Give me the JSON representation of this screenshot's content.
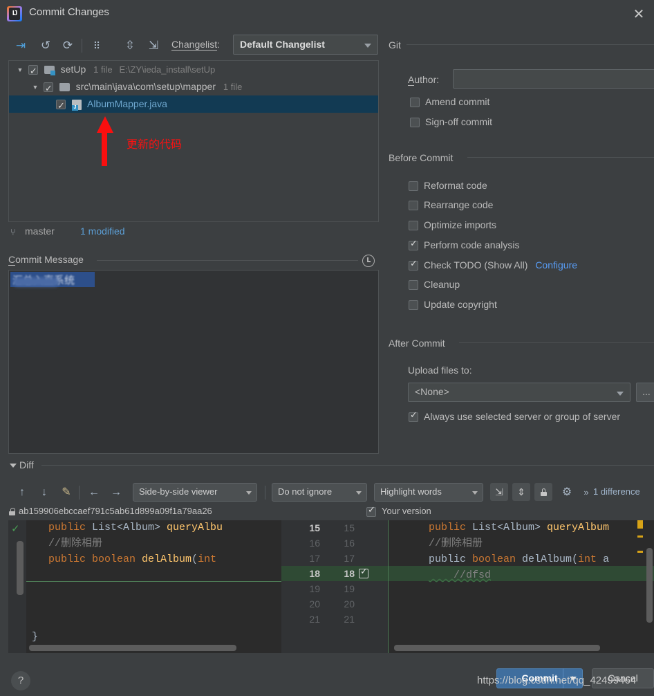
{
  "window": {
    "title": "Commit Changes",
    "app_icon": "intellij-idea-icon",
    "close_icon": "✕"
  },
  "toolbar": {
    "icons": [
      {
        "name": "show-diff-icon",
        "glyph": "⇥"
      },
      {
        "name": "revert-icon",
        "glyph": "↺"
      },
      {
        "name": "refresh-icon",
        "glyph": "⟳"
      },
      {
        "name": "group-by-icon",
        "glyph": "⠿"
      },
      {
        "name": "expand-all-icon",
        "glyph": "⇳"
      },
      {
        "name": "collapse-all-icon",
        "glyph": "⇲"
      }
    ],
    "changelist_label": "Changelist:",
    "changelist_value": "Default Changelist"
  },
  "file_tree": {
    "rows": [
      {
        "name": "setUp",
        "meta": "1 file",
        "path": "E:\\ZY\\ieda_install\\setUp",
        "checked": true,
        "expanded": true,
        "selected": false,
        "type": "module"
      },
      {
        "name": "src\\main\\java\\com\\setup\\mapper",
        "meta": "1 file",
        "path": "",
        "checked": true,
        "expanded": true,
        "selected": false,
        "type": "folder"
      },
      {
        "name": "AlbumMapper.java",
        "meta": "",
        "path": "",
        "checked": true,
        "expanded": false,
        "selected": true,
        "type": "java"
      }
    ]
  },
  "annotation": {
    "text": "更新的代码",
    "color": "#fb1111"
  },
  "status": {
    "branch_icon": "branch-icon",
    "branch": "master",
    "modified": "1 modified"
  },
  "commit_message": {
    "label": "Commit Message",
    "history_icon": "history-clock-icon",
    "value": "汇总入直系统",
    "redacted": true
  },
  "git_section": {
    "title": "Git",
    "author_label": "Author:",
    "author_value": "",
    "checkboxes": [
      {
        "label": "Amend commit",
        "checked": false,
        "mnemonic": "m"
      },
      {
        "label": "Sign-off commit",
        "checked": false,
        "mnemonic": "g"
      }
    ]
  },
  "before_commit": {
    "title": "Before Commit",
    "checkboxes": [
      {
        "label": "Reformat code",
        "checked": false,
        "mnemonic": "R"
      },
      {
        "label": "Rearrange code",
        "checked": false,
        "mnemonic": "n"
      },
      {
        "label": "Optimize imports",
        "checked": false,
        "mnemonic": "O"
      },
      {
        "label": "Perform code analysis",
        "checked": true,
        "mnemonic": "s"
      },
      {
        "label": "Check TODO (Show All)",
        "checked": true,
        "link": "Configure"
      },
      {
        "label": "Cleanup",
        "checked": false,
        "mnemonic": "l"
      },
      {
        "label": "Update copyright",
        "checked": false,
        "mnemonic": ""
      }
    ]
  },
  "after_commit": {
    "title": "After Commit",
    "upload_label": "Upload files to:",
    "upload_value": "<None>",
    "browse_button": "...",
    "always_use_label": "Always use selected server or group of server",
    "always_use_checked": true
  },
  "diff": {
    "title": "Diff",
    "nav_icons": [
      {
        "name": "previous-difference-icon",
        "glyph": "↑"
      },
      {
        "name": "next-difference-icon",
        "glyph": "↓"
      },
      {
        "name": "edit-source-icon",
        "glyph": "✎"
      },
      {
        "name": "accept-left-icon",
        "glyph": "←"
      },
      {
        "name": "accept-right-icon",
        "glyph": "→"
      }
    ],
    "viewer_mode": "Side-by-side viewer",
    "ignore_mode": "Do not ignore",
    "highlight_mode": "Highlight words",
    "toggle_icons": [
      {
        "name": "collapse-unchanged-icon",
        "glyph": "⇲"
      },
      {
        "name": "synchronize-scrolling-icon",
        "glyph": "⇕"
      },
      {
        "name": "read-only-lock-icon",
        "glyph": "🔒"
      },
      {
        "name": "settings-gear-icon",
        "glyph": "⚙"
      },
      {
        "name": "more-options-icon",
        "glyph": "»"
      }
    ],
    "difference_count": "1 difference",
    "left_header": "ab159906ebccaef791c5ab61d899a09f1a79aa26",
    "left_header_icon": "lock-icon",
    "right_header": "Your version",
    "right_header_checked": true,
    "left_lines": [
      {
        "text": "    public List<Album> queryAlbu",
        "marker": "check"
      },
      {
        "text": "    //删除相册",
        "marker": ""
      },
      {
        "text": "    public boolean delAlbum(int",
        "marker": ""
      },
      {
        "text": "",
        "marker": ""
      },
      {
        "text": "",
        "marker": ""
      },
      {
        "text": "",
        "marker": ""
      },
      {
        "text": "}",
        "marker": ""
      }
    ],
    "right_lines": [
      {
        "old_no": "15",
        "new_no": "15",
        "text": "    public List<Album> queryAlbum",
        "added": false,
        "checked": false
      },
      {
        "old_no": "16",
        "new_no": "16",
        "text": "    //删除相册",
        "added": false,
        "checked": false
      },
      {
        "old_no": "17",
        "new_no": "17",
        "text": "    public boolean delAlbum(int a",
        "added": false,
        "checked": false
      },
      {
        "old_no": "18",
        "new_no": "18",
        "text": "    //dfsd",
        "added": true,
        "checked": true
      },
      {
        "old_no": "19",
        "new_no": "19",
        "text": "",
        "added": false,
        "checked": false
      },
      {
        "old_no": "20",
        "new_no": "20",
        "text": "",
        "added": false,
        "checked": false
      },
      {
        "old_no": "21",
        "new_no": "21",
        "text": "",
        "added": false,
        "checked": false
      }
    ]
  },
  "footer": {
    "help_label": "?",
    "commit_label": "Commit",
    "commit_dropdown_icon": "chevron-down-icon",
    "cancel_label": "Cancel",
    "watermark": "https://blog.csdn.net/qq_42499464"
  },
  "colors": {
    "background": "#3c3f41",
    "panel": "#313335",
    "editor": "#2b2b2b",
    "selection": "#123a53",
    "accent": "#589df6",
    "added": "#2f4a34",
    "annotation": "#fb1111",
    "primary_button": "#3f6e9e"
  }
}
